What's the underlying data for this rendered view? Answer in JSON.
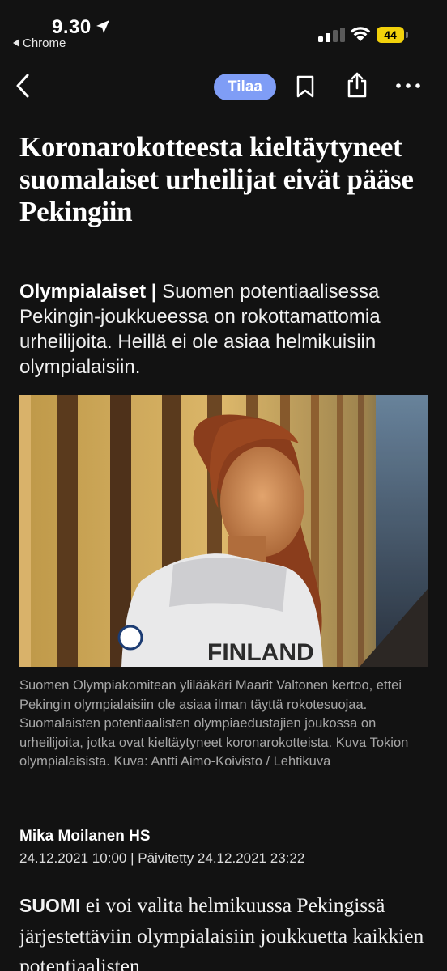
{
  "status_bar": {
    "time": "9.30",
    "back_app": "Chrome",
    "battery": "44",
    "battery_color": "#f2d10b"
  },
  "nav": {
    "subscribe_label": "Tilaa",
    "accent": "#7f9df6",
    "icons": [
      "back-chevron-icon",
      "bookmark-icon",
      "share-icon",
      "more-icon"
    ]
  },
  "article": {
    "headline": "Koronarokotteesta kieltäytyneet suomalaiset urheilijat eivät pääse Pekingiin",
    "kicker": "Olympialaiset",
    "kicker_separator": " | ",
    "lead": "Suomen potentiaalisessa Pekingin-joukkueessa on rokottamattomia urheilijoita. Heillä ei ole asiaa helmikuisiin olympialaisiin.",
    "caption": "Suomen Olympiakomitean ylilääkäri Maarit Valtonen kertoo, ettei Pekingin olympialaisiin ole asiaa ilman täyttä rokotesuojaa. Suomalaisten potentiaalisten olympiaedustajien joukossa on urheilijoita, jotka ovat kieltäytyneet koronarokotteista. Kuva Tokion olympialaisista. Kuva: Antti Aimo-Koivisto / Lehtikuva",
    "photo_text": "FINLAND",
    "author": "Mika Moilanen HS",
    "published": "24.12.2021 10:00",
    "date_separator": " | ",
    "updated": "Päivitetty 24.12.2021 23:22",
    "body_lead_caps": "SUOMI",
    "body_text": " ei voi valita helmikuussa Pekingissä järjestettäviin olympialaisiin joukkuetta kaikkien potentiaalisten"
  }
}
